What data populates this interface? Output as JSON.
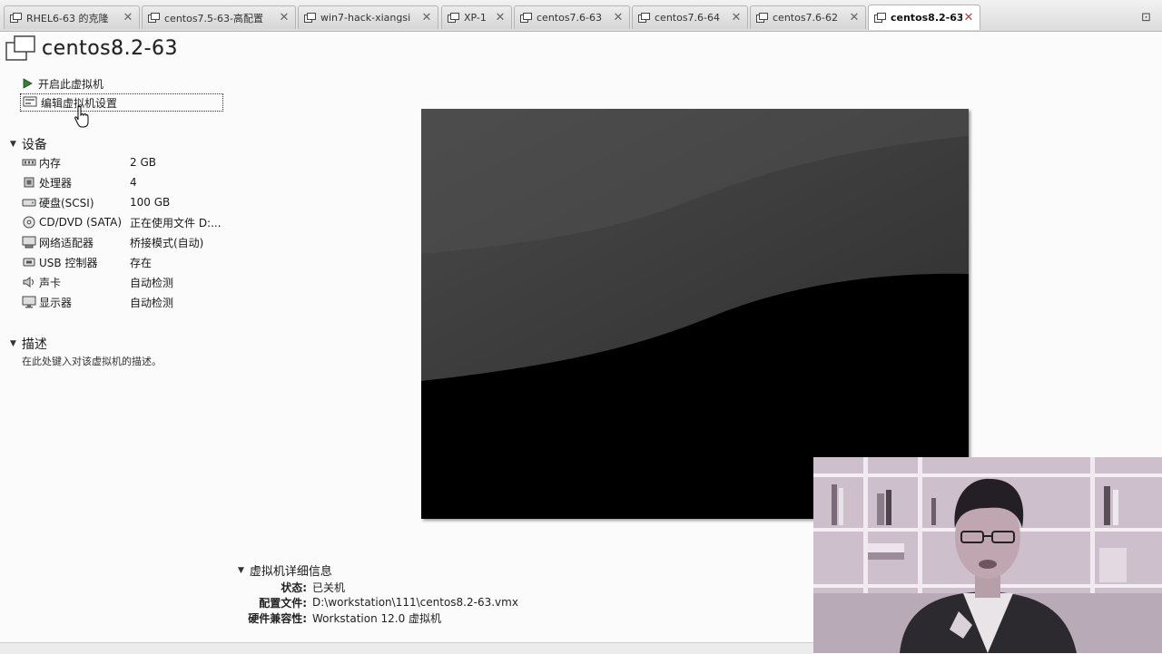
{
  "tabs": [
    {
      "label": "RHEL6-63 的克隆",
      "active": false
    },
    {
      "label": "centos7.5-63-高配置",
      "active": false
    },
    {
      "label": "win7-hack-xiangsi",
      "active": false
    },
    {
      "label": "XP-1",
      "active": false
    },
    {
      "label": "centos7.6-63",
      "active": false
    },
    {
      "label": "centos7.6-64",
      "active": false
    },
    {
      "label": "centos7.6-62",
      "active": false
    },
    {
      "label": "centos8.2-63",
      "active": true
    }
  ],
  "vm": {
    "title": "centos8.2-63"
  },
  "actions": {
    "power_on": "开启此虚拟机",
    "edit_settings": "编辑虚拟机设置"
  },
  "devices": {
    "header": "设备",
    "items": [
      {
        "icon": "memory-icon",
        "name": "内存",
        "value": "2 GB"
      },
      {
        "icon": "cpu-icon",
        "name": "处理器",
        "value": "4"
      },
      {
        "icon": "disk-icon",
        "name": "硬盘(SCSI)",
        "value": "100 GB"
      },
      {
        "icon": "cd-dvd-icon",
        "name": "CD/DVD (SATA)",
        "value": "正在使用文件 D:..."
      },
      {
        "icon": "network-icon",
        "name": "网络适配器",
        "value": "桥接模式(自动)"
      },
      {
        "icon": "usb-icon",
        "name": "USB 控制器",
        "value": "存在"
      },
      {
        "icon": "sound-icon",
        "name": "声卡",
        "value": "自动检测"
      },
      {
        "icon": "display-icon",
        "name": "显示器",
        "value": "自动检测"
      }
    ]
  },
  "description": {
    "header": "描述",
    "placeholder": "在此处键入对该虚拟机的描述。"
  },
  "details": {
    "header": "虚拟机详细信息",
    "rows": [
      {
        "key": "状态:",
        "value": "已关机"
      },
      {
        "key": "配置文件:",
        "value": "D:\\workstation\\111\\centos8.2-63.vmx"
      },
      {
        "key": "硬件兼容性:",
        "value": "Workstation 12.0 虚拟机"
      }
    ]
  },
  "colors": {
    "accent_close": "#c23b3b",
    "preview_bg": "#000000"
  }
}
